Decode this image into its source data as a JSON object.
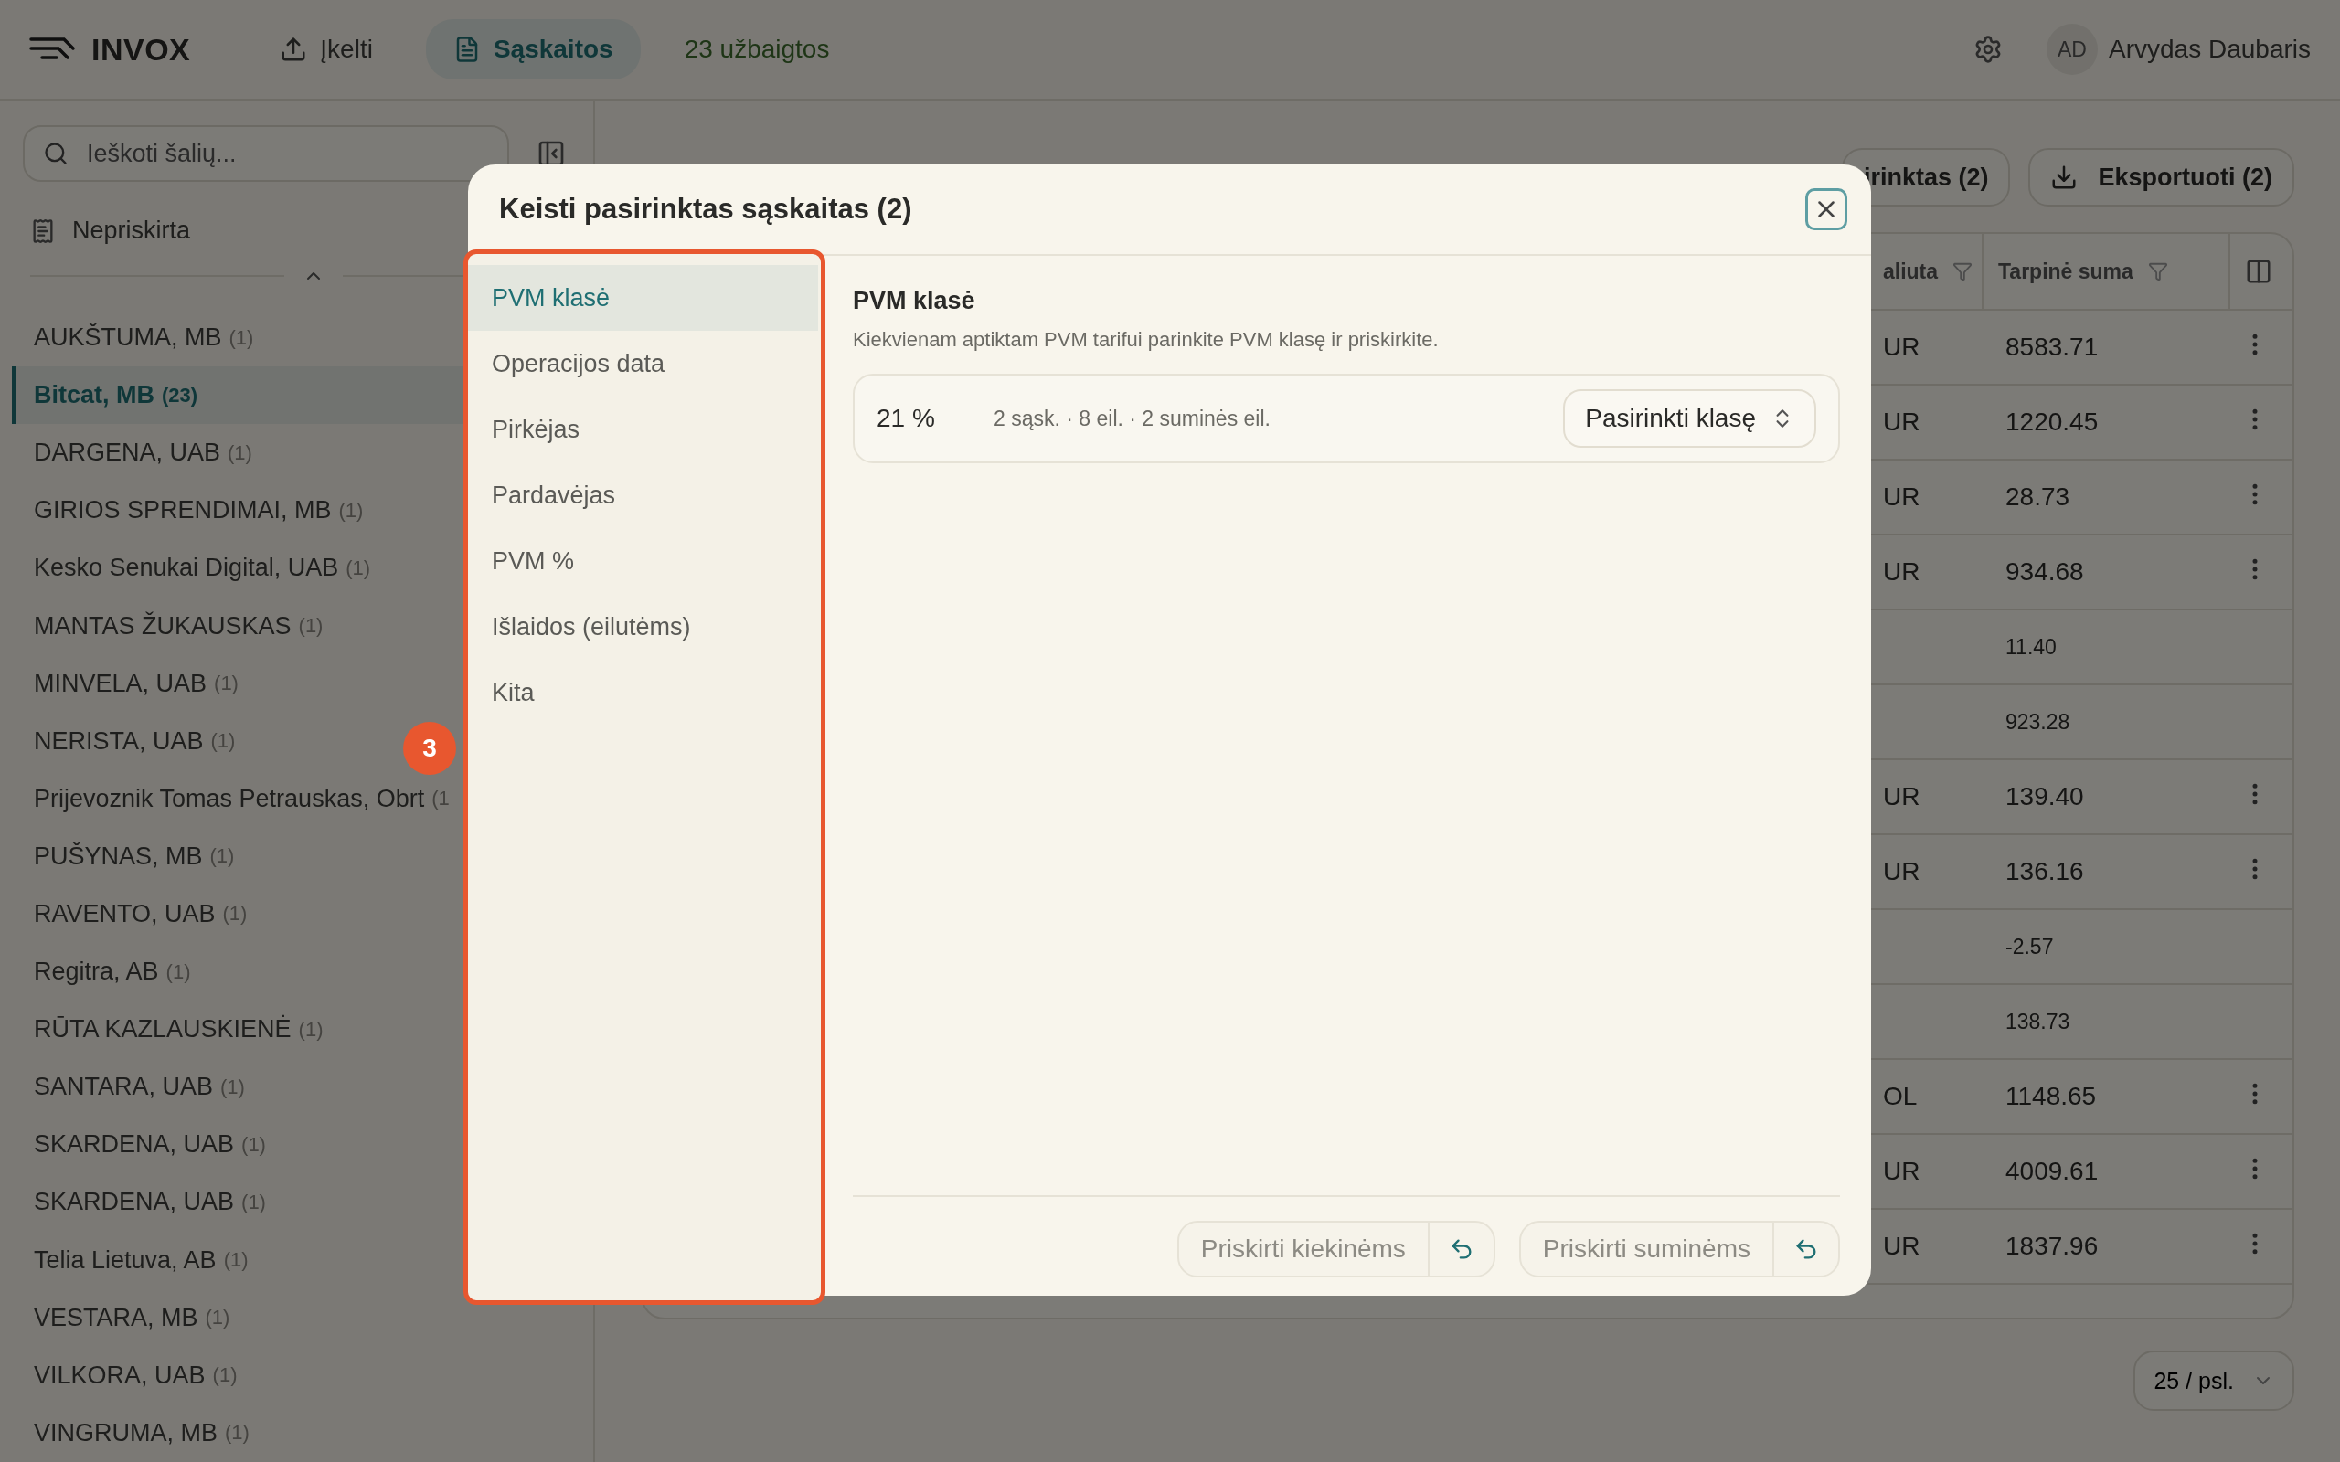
{
  "header": {
    "logo": "INVOX",
    "nav": [
      {
        "label": "Įkelti",
        "selected": false
      },
      {
        "label": "Sąskaitos",
        "selected": true
      }
    ],
    "status": "23 užbaigtos",
    "user": {
      "initials": "AD",
      "name": "Arvydas Daubaris"
    }
  },
  "sidebar": {
    "search": {
      "placeholder": "Ieškoti šalių..."
    },
    "unassigned": "Nepriskirta",
    "parties": [
      {
        "name": "AUKŠTUMA, MB",
        "count": "(1)",
        "selected": false
      },
      {
        "name": "Bitcat, MB",
        "count": "(23)",
        "selected": true
      },
      {
        "name": "DARGENA, UAB",
        "count": "(1)",
        "selected": false
      },
      {
        "name": "GIRIOS SPRENDIMAI, MB",
        "count": "(1)",
        "selected": false
      },
      {
        "name": "Kesko Senukai Digital, UAB",
        "count": "(1)",
        "selected": false
      },
      {
        "name": "MANTAS ŽUKAUSKAS",
        "count": "(1)",
        "selected": false
      },
      {
        "name": "MINVELA, UAB",
        "count": "(1)",
        "selected": false
      },
      {
        "name": "NERISTA, UAB",
        "count": "(1)",
        "selected": false
      },
      {
        "name": "Prijevoznik Tomas Petrauskas, Obrt",
        "count": "(1",
        "selected": false
      },
      {
        "name": "PUŠYNAS, MB",
        "count": "(1)",
        "selected": false
      },
      {
        "name": "RAVENTO, UAB",
        "count": "(1)",
        "selected": false
      },
      {
        "name": "Regitra, AB",
        "count": "(1)",
        "selected": false
      },
      {
        "name": "RŪTA KAZLAUSKIENĖ",
        "count": "(1)",
        "selected": false
      },
      {
        "name": "SANTARA, UAB",
        "count": "(1)",
        "selected": false
      },
      {
        "name": "SKARDENA, UAB",
        "count": "(1)",
        "selected": false
      },
      {
        "name": "SKARDENA, UAB",
        "count": "(1)",
        "selected": false
      },
      {
        "name": "Telia Lietuva, AB",
        "count": "(1)",
        "selected": false
      },
      {
        "name": "VESTARA, MB",
        "count": "(1)",
        "selected": false
      },
      {
        "name": "VILKORA, UAB",
        "count": "(1)",
        "selected": false
      },
      {
        "name": "VINGRUMA, MB",
        "count": "(1)",
        "selected": false
      }
    ]
  },
  "toolbar": {
    "assign_button": "irinktas (2)",
    "export_button": "Eksportuoti (2)"
  },
  "table": {
    "columns": [
      "aliuta",
      "Tarpinė suma"
    ],
    "rows": [
      {
        "kind": "invoice",
        "currency": "UR",
        "subtotal": "8583.71"
      },
      {
        "kind": "invoice",
        "currency": "UR",
        "subtotal": "1220.45"
      },
      {
        "kind": "invoice",
        "currency": "UR",
        "subtotal": "28.73"
      },
      {
        "kind": "invoice",
        "currency": "UR",
        "subtotal": "934.68"
      },
      {
        "kind": "line",
        "subtotal": "11.40"
      },
      {
        "kind": "line",
        "subtotal": "923.28"
      },
      {
        "kind": "invoice",
        "currency": "UR",
        "subtotal": "139.40"
      },
      {
        "kind": "invoice",
        "currency": "UR",
        "subtotal": "136.16"
      },
      {
        "kind": "line",
        "subtotal": "-2.57"
      },
      {
        "kind": "line",
        "subtotal": "138.73"
      },
      {
        "kind": "invoice",
        "currency": "OL",
        "subtotal": "1148.65"
      },
      {
        "kind": "invoice",
        "currency": "UR",
        "subtotal": "4009.61"
      },
      {
        "kind": "invoice",
        "currency": "UR",
        "subtotal": "1837.96"
      }
    ]
  },
  "pagination": "25 / psl.",
  "modal": {
    "title": "Keisti pasirinktas sąskaitas (2)",
    "nav": [
      {
        "label": "PVM klasė",
        "selected": true
      },
      {
        "label": "Operacijos data",
        "selected": false
      },
      {
        "label": "Pirkėjas",
        "selected": false
      },
      {
        "label": "Pardavėjas",
        "selected": false
      },
      {
        "label": "PVM %",
        "selected": false
      },
      {
        "label": "Išlaidos (eilutėms)",
        "selected": false
      },
      {
        "label": "Kita",
        "selected": false
      }
    ],
    "section": {
      "title": "PVM klasė",
      "description": "Kiekvienam aptiktam PVM tarifui parinkite PVM klasę ir priskirkite.",
      "rates": [
        {
          "rate": "21 %",
          "summary": "2 sąsk. · 8 eil. · 2 suminės eil.",
          "select": "Pasirinkti klasę"
        }
      ]
    },
    "actions": [
      {
        "label": "Priskirti kiekinėms",
        "disabled": true
      },
      {
        "label": "Priskirti suminėms",
        "disabled": true
      }
    ]
  },
  "annotation": {
    "badge": "3"
  }
}
